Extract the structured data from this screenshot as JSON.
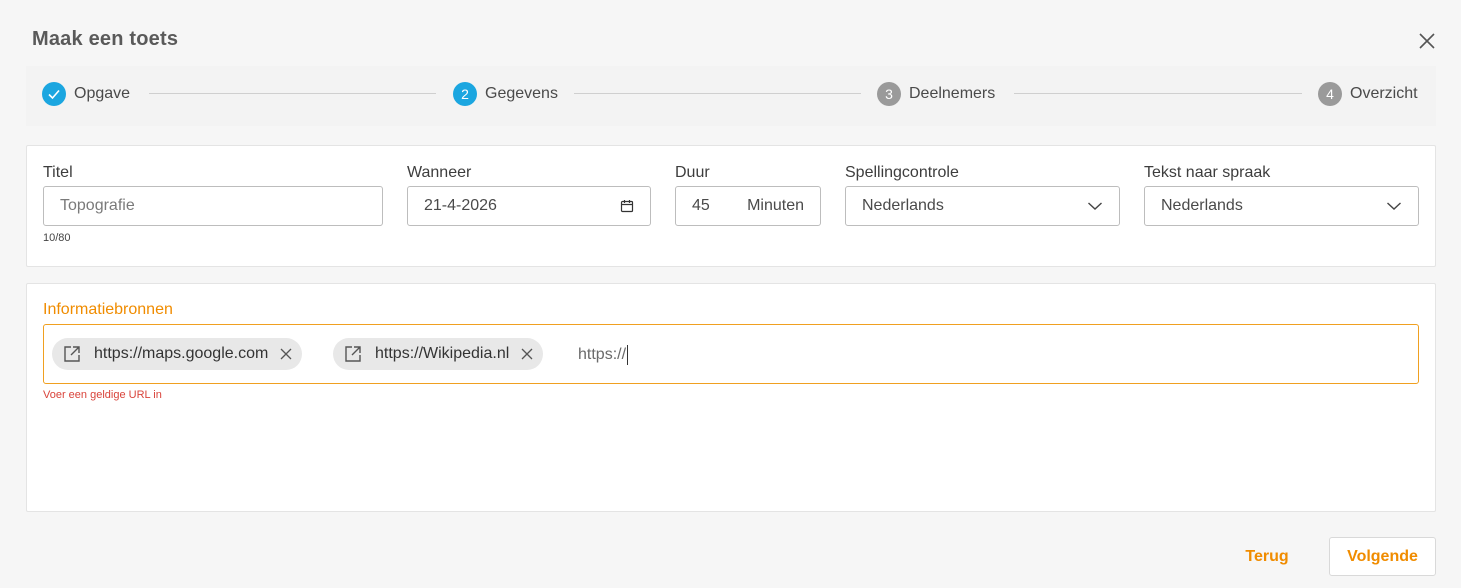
{
  "dialog": {
    "title": "Maak een toets"
  },
  "steps": [
    {
      "number": "",
      "label": "Opgave",
      "state": "done"
    },
    {
      "number": "2",
      "label": "Gegevens",
      "state": "active"
    },
    {
      "number": "3",
      "label": "Deelnemers",
      "state": "pending"
    },
    {
      "number": "4",
      "label": "Overzicht",
      "state": "pending"
    }
  ],
  "details": {
    "title_label": "Titel",
    "title_placeholder": "Topografie",
    "title_counter": "10/80",
    "when_label": "Wanneer",
    "when_value": "21-4-2026",
    "duration_label": "Duur",
    "duration_value": "45",
    "duration_unit": "Minuten",
    "spelling_label": "Spellingcontrole",
    "spelling_value": "Nederlands",
    "tts_label": "Tekst naar spraak",
    "tts_value": "Nederlands"
  },
  "sources": {
    "label": "Informatiebronnen",
    "chips": [
      "https://maps.google.com",
      "https://Wikipedia.nl"
    ],
    "input_value": "https://",
    "error": "Voer een geldige URL in"
  },
  "footer": {
    "back_label": "Terug",
    "next_label": "Volgende"
  },
  "colors": {
    "accent_orange": "#f08c00",
    "step_active_blue": "#1ba6e0",
    "step_pending_grey": "#9a9a9a",
    "error_red": "#d9433a"
  },
  "icons": [
    "close-icon",
    "check-icon",
    "calendar-icon",
    "chevron-down-icon",
    "external-link-icon",
    "remove-icon"
  ]
}
